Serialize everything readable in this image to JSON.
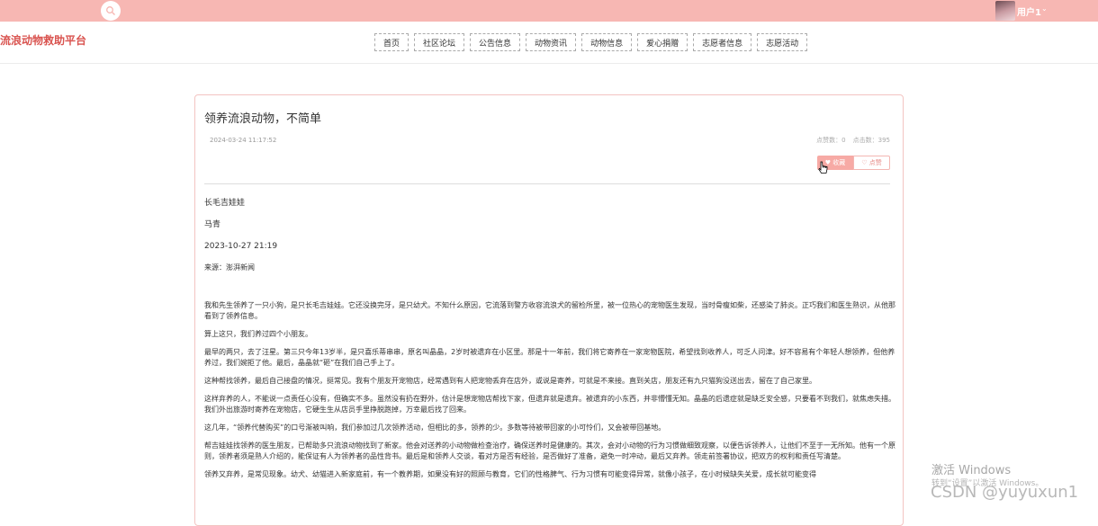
{
  "topbar": {
    "user_name": "用户1",
    "caret": "⌄"
  },
  "header": {
    "logo": "流浪动物救助平台",
    "nav": [
      "首页",
      "社区论坛",
      "公告信息",
      "动物资讯",
      "动物信息",
      "爱心捐赠",
      "志愿者信息",
      "志愿活动"
    ]
  },
  "article": {
    "title": "领养流浪动物，不简单",
    "date": "2024-03-24 11:17:52",
    "click_count": "点赞数：0",
    "view_count": "点击数：395",
    "fav_label": "♥ 收藏",
    "like_label": "♡ 点赞",
    "author_nick": "长毛吉娃娃",
    "author": "马青",
    "pub_time": "2023-10-27 21:19",
    "source": "来源：澎湃新闻",
    "paragraphs": [
      "我和先生领养了一只小狗，是只长毛吉娃娃。它还没换完牙，是只幼犬。不知什么原因，它流落到警方收容流浪犬的留检所里，被一位热心的宠物医生发现，当时骨瘦如柴，还感染了肺炎。正巧我们和医生熟识，从他那看到了领养信息。",
      "算上这只，我们养过四个小朋友。",
      "最早的两只，去了汪星。第三只今年13岁半，是只喜乐蒂串串，原名叫晶晶，2岁时被遗弃在小区里。那是十一年前，我们将它寄养在一家宠物医院，希望找到收养人，可乏人问津。好不容易有个年轻人想领养，但他养养过，我们婉拒了他。最后，晶晶就“砸”在我们自己手上了。",
      "这种帮找领养，最后自己接盘的情况，挺常见。我有个朋友开宠物店，经常遇到有人把宠物丢弃在店外，或说是寄养，可就是不来接。直到关店，朋友还有九只猫狗没送出去，留在了自己家里。",
      "这样弃养的人，不能说一点责任心没有，但确实不多。虽然没有扔在野外，估计是想宠物店帮找下家，但遗弃就是遗弃。被遗弃的小东西，并非懵懂无知。晶晶的后遗症就是缺乏安全感，只要看不到我们，就焦虑失措。我们外出旅游时寄养在宠物店，它硬生生从店员手里挣脱跑掉，万幸最后找了回来。",
      "这几年，“领养代替购买”的口号渐被叫响，我们参加过几次领养活动，但相比的多，领养的少。多数等待被带回家的小可怜们，又会被带回基地。",
      "帮吉娃娃找领养的医生朋友，已帮助多只流浪动物找到了新家。他会对送养的小动物做检查治疗，确保送养时是健康的。其次，会对小动物的行为习惯做细致观察，以便告诉领养人，让他们不至于一无所知。他有一个原则，领养者须是熟人介绍的，能保证有人为领养者的品性背书。最后是和领养人交谈，看对方是否有经验，是否做好了准备，避免一时冲动，最后又弃养。领走前签署协议，把双方的权利和责任写清楚。",
      "领养又弃养，是常见现象。幼犬、幼猫进入新家庭前，有一个教养期，如果没有好的照顾与教育，它们的性格脾气、行为习惯有可能变得异常，就像小孩子，在小时候缺失关爱，成长就可能变得"
    ]
  },
  "watermark": {
    "win_title": "激活 Windows",
    "win_sub": "转到“设置”以激活 Windows。",
    "csdn": "CSDN @yuyuxun1"
  },
  "colors": {
    "topbar": "#f7b7b3",
    "logo": "#d9534f",
    "accent": "#f7aaa5"
  },
  "icons": {
    "search": "search-icon",
    "avatar": "avatar",
    "cursor": "pointer-cursor-icon"
  }
}
